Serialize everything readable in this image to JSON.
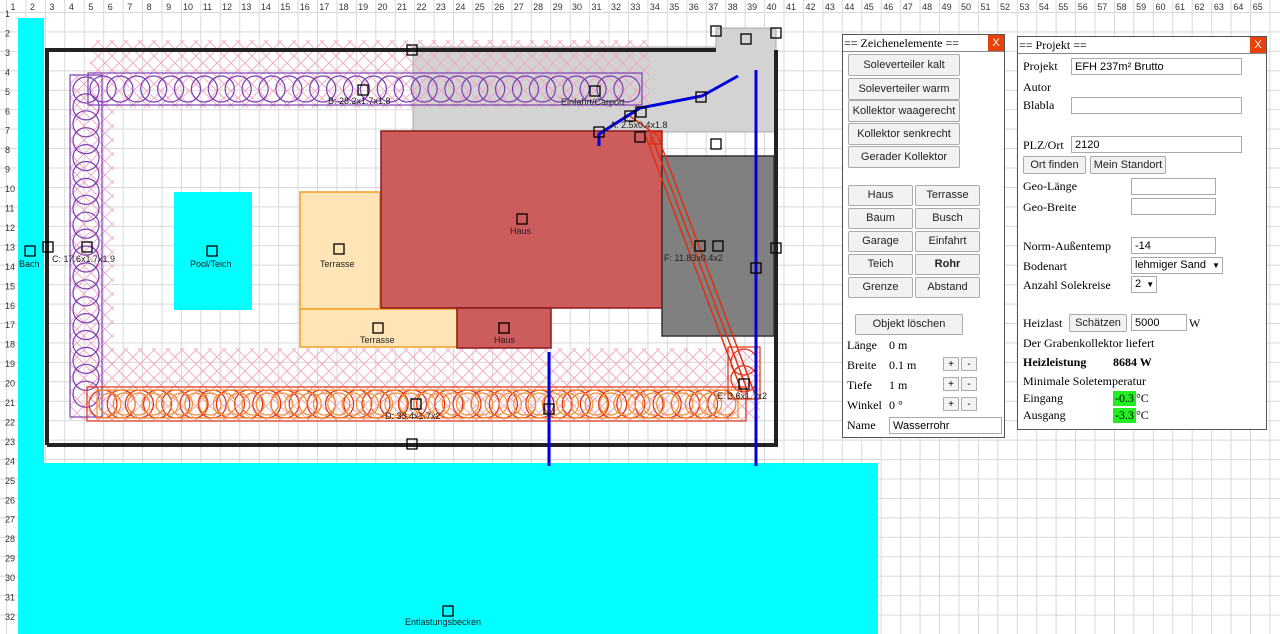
{
  "ruler": {
    "top": [
      "1",
      "2",
      "3",
      "4",
      "5",
      "6",
      "7",
      "8",
      "9",
      "10",
      "11",
      "12",
      "13",
      "14",
      "15",
      "16",
      "17",
      "18",
      "19",
      "20",
      "21",
      "22",
      "23",
      "24",
      "25",
      "26",
      "27",
      "28",
      "29",
      "30",
      "31",
      "32",
      "33",
      "34",
      "35",
      "36",
      "37",
      "38",
      "39",
      "40",
      "41",
      "42",
      "43",
      "44",
      "45",
      "46",
      "47",
      "48",
      "49",
      "50",
      "51",
      "52",
      "53",
      "54",
      "55",
      "56",
      "57",
      "58",
      "59",
      "60",
      "61",
      "62",
      "63",
      "64",
      "65"
    ],
    "left": [
      "1",
      "2",
      "3",
      "4",
      "5",
      "6",
      "7",
      "8",
      "9",
      "10",
      "11",
      "12",
      "13",
      "14",
      "15",
      "16",
      "17",
      "18",
      "19",
      "20",
      "21",
      "22",
      "23",
      "24",
      "25",
      "26",
      "27",
      "28",
      "29",
      "30",
      "31",
      "32"
    ]
  },
  "canvas": {
    "labels": {
      "bach": "Bach",
      "pool": "Pool/Teich",
      "terrasse1": "Terrasse",
      "terrasse2": "Terrasse",
      "haus1": "Haus",
      "haus2": "Haus",
      "einfahrt": "Einfahrt/Carport",
      "coll_a": "A: 2.5x0.4x1.8",
      "coll_b": "B: 28.2x1.7x1.8",
      "coll_c": "C: 17.6x1.7x1.9",
      "coll_d": "D: 33.4x1.7x2",
      "coll_e": "E: 3.6x1.7x2",
      "coll_f": "F: 11.83x0.4x2",
      "becken": "Entlastungsbecken"
    },
    "colors": {
      "water": "#00ffff",
      "house": "#cd5c5c",
      "terrace": "#ffe4b5",
      "terrace_border": "#f0a020",
      "garage": "#808080",
      "driveway": "#d3d3d3",
      "collector_purple": "#7b3fb5",
      "collector_red": "#e03010",
      "pipe_blue": "#0000dd",
      "boundary": "#222222"
    }
  },
  "elements_panel": {
    "title": "== Zeichenelemente ==",
    "close": "X",
    "buttons": [
      "Soleverteiler kalt",
      "Soleverteiler warm",
      "Kollektor waagerecht",
      "Kollektor senkrecht",
      "Gerader Kollektor"
    ],
    "grid_buttons": [
      "Haus",
      "Terrasse",
      "Baum",
      "Busch",
      "Garage",
      "Einfahrt",
      "Teich",
      "Rohr",
      "Grenze",
      "Abstand"
    ],
    "delete_button": "Objekt löschen",
    "props": {
      "laenge_label": "Länge",
      "laenge_value": "0 m",
      "breite_label": "Breite",
      "breite_value": "0.1 m",
      "tiefe_label": "Tiefe",
      "tiefe_value": "1 m",
      "winkel_label": "Winkel",
      "winkel_value": "0 °",
      "name_label": "Name",
      "name_value": "Wasserrohr",
      "plus": "+",
      "minus": "-"
    }
  },
  "project_panel": {
    "title": "== Projekt ==",
    "close": "X",
    "projekt_label": "Projekt",
    "projekt_value": "EFH 237m² Brutto",
    "autor_label": "Autor",
    "blabla_label": "Blabla",
    "blabla_value": "",
    "plz_label": "PLZ/Ort",
    "plz_value": "2120",
    "ort_finden": "Ort finden",
    "mein_standort": "Mein Standort",
    "geo_laenge_label": "Geo-Länge",
    "geo_laenge_value": "",
    "geo_breite_label": "Geo-Breite",
    "geo_breite_value": "",
    "norm_label": "Norm-Außentemp",
    "norm_value": "-14",
    "bodenart_label": "Bodenart",
    "bodenart_value": "lehmiger Sand",
    "solekreise_label": "Anzahl Solekreise",
    "solekreise_value": "2",
    "heizlast_label": "Heizlast",
    "schaetzen": "Schätzen",
    "heizlast_value": "5000",
    "heizlast_unit": "W",
    "liefert_text": "Der Grabenkollektor liefert",
    "heizleistung_label": "Heizleistung",
    "heizleistung_value": "8684 W",
    "min_sole_text": "Minimale Soletemperatur",
    "eingang_label": "Eingang",
    "eingang_value": "-0.3",
    "eingang_unit": "°C",
    "ausgang_label": "Ausgang",
    "ausgang_value": "-3.3",
    "ausgang_unit": "°C"
  }
}
